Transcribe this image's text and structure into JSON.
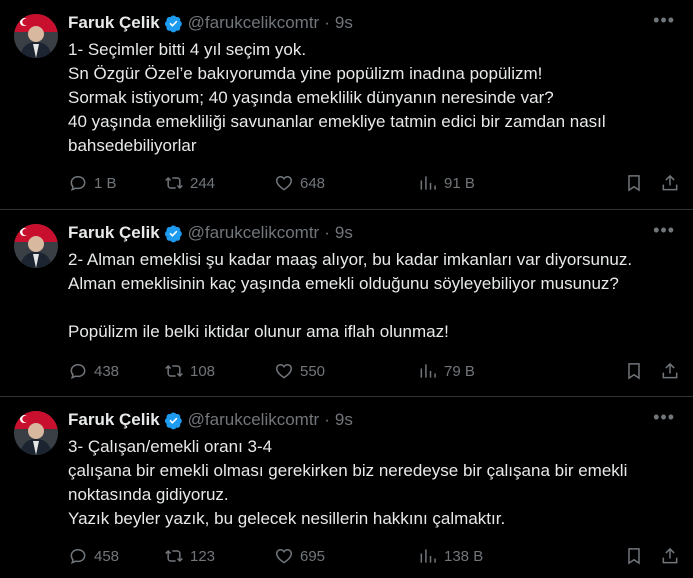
{
  "tweets": [
    {
      "author_name": "Faruk Çelik",
      "handle": "@farukcelikcomtr",
      "separator": "·",
      "time": "9s",
      "text": "1- Seçimler bitti 4 yıl seçim yok.\nSn Özgür Özel’e bakıyorumda yine popülizm inadına popülizm!\nSormak istiyorum; 40 yaşında emeklilik dünyanın neresinde var?\n40 yaşında emekliliği savunanlar emekliye tatmin edici bir zamdan nasıl bahsedebiliyorlar",
      "replies": "1 B",
      "reposts": "244",
      "likes": "648",
      "views": "91 B"
    },
    {
      "author_name": "Faruk Çelik",
      "handle": "@farukcelikcomtr",
      "separator": "·",
      "time": "9s",
      "text": "2- Alman emeklisi şu kadar maaş alıyor, bu kadar imkanları var diyorsunuz.\nAlman emeklisinin kaç yaşında emekli olduğunu söyleyebiliyor musunuz?\n\nPopülizm ile belki iktidar olunur ama iflah olunmaz!",
      "replies": "438",
      "reposts": "108",
      "likes": "550",
      "views": "79 B"
    },
    {
      "author_name": "Faruk Çelik",
      "handle": "@farukcelikcomtr",
      "separator": "·",
      "time": "9s",
      "text": "3- Çalışan/emekli oranı 3-4\nçalışana bir emekli olması gerekirken biz neredeyse bir çalışana bir emekli noktasında gidiyoruz.\nYazık beyler yazık,  bu gelecek nesillerin hakkını çalmaktır.",
      "replies": "458",
      "reposts": "123",
      "likes": "695",
      "views": "138 B"
    }
  ],
  "icons": {
    "more": "more-dots-icon",
    "verified": "verified-badge-icon",
    "reply": "reply-icon",
    "repost": "repost-icon",
    "like": "heart-icon",
    "views": "views-chart-icon",
    "bookmark": "bookmark-icon",
    "share": "share-icon"
  },
  "colors": {
    "background": "#000000",
    "text": "#e7e9ea",
    "muted": "#71767b",
    "verified": "#1d9bf0",
    "divider": "#2f3336"
  }
}
